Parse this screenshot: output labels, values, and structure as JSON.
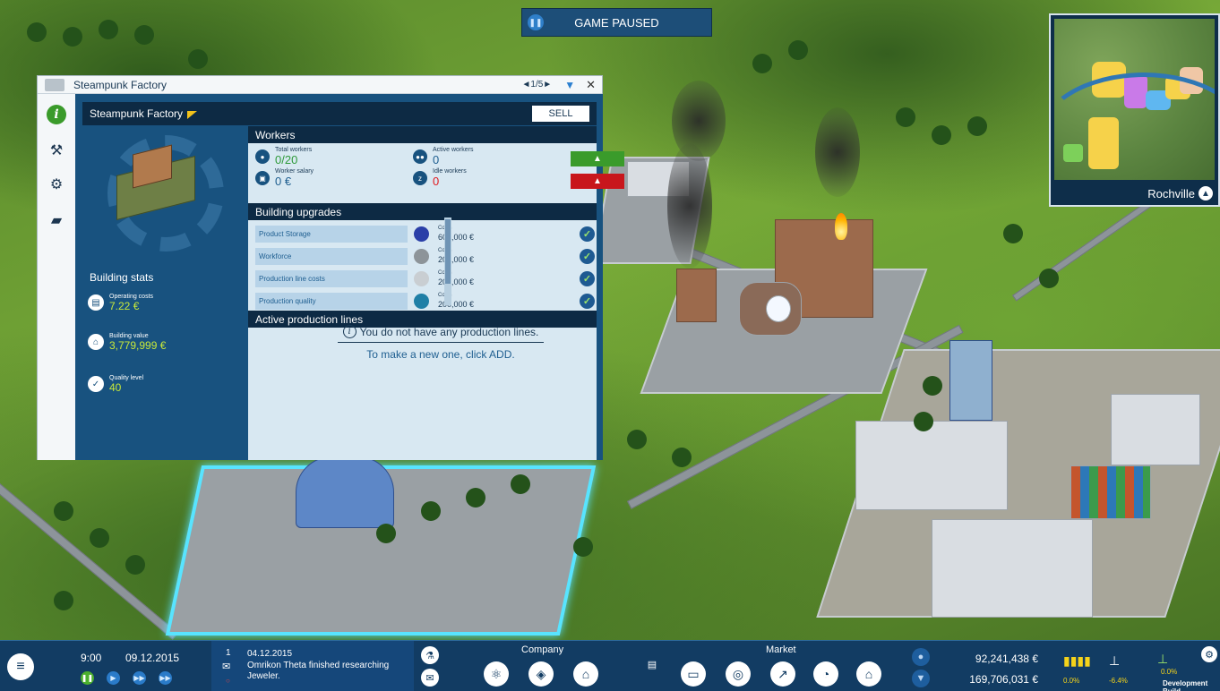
{
  "top_banner": {
    "label": "GAME PAUSED"
  },
  "minimap": {
    "city_name": "Rochville"
  },
  "factory_window": {
    "title": "Steampunk Factory",
    "pager": "◄1/5►",
    "pin_icon": "pin-icon",
    "close_label": "✕",
    "building_name": "Steampunk Factory",
    "sell_label": "SELL",
    "building_stats": {
      "title": "Building stats",
      "operating_costs_label": "Operating costs",
      "operating_costs_value": "7.22 €",
      "building_value_label": "Building value",
      "building_value_value": "3,779,999 €",
      "quality_level_label": "Quality level",
      "quality_level_value": "40"
    },
    "workers": {
      "title": "Workers",
      "total_label": "Total workers",
      "total_value": "0/20",
      "salary_label": "Worker salary",
      "salary_value": "0 €",
      "active_label": "Active workers",
      "active_value": "0",
      "idle_label": "Idle workers",
      "idle_value": "0",
      "hire_color": "#3a9b2b",
      "fire_color": "#c8161c"
    },
    "upgrades": {
      "title": "Building upgrades",
      "costs_label": "Costs",
      "items": [
        {
          "name": "Product Storage",
          "cost": "600,000 €",
          "done": true
        },
        {
          "name": "Workforce",
          "cost": "200,000 €",
          "done": true
        },
        {
          "name": "Production line costs",
          "cost": "200,000 €",
          "done": true
        },
        {
          "name": "Production quality",
          "cost": "200,000 €",
          "done": true
        }
      ]
    },
    "production_lines": {
      "title": "Active production lines",
      "empty_text": "You do not have any production lines.",
      "hint_text": "To make a new one, click ADD."
    }
  },
  "hud": {
    "time": "9:00",
    "date": "09.12.2015",
    "news_count": "1",
    "news_date": "04.12.2015",
    "news_text": "Omrikon Theta finished researching Jeweler.",
    "company_label": "Company",
    "market_label": "Market",
    "money_top": "92,241,438 €",
    "money_bottom": "169,706,031 €",
    "stat_1": "0.0%",
    "stat_2": "-6.4%",
    "stat_3": "0.0%",
    "dev_build": "Development Build"
  },
  "colors": {
    "accent": "#18527f",
    "dark": "#0d2a44",
    "positive": "#c7e83a",
    "negative": "#e0191f"
  }
}
